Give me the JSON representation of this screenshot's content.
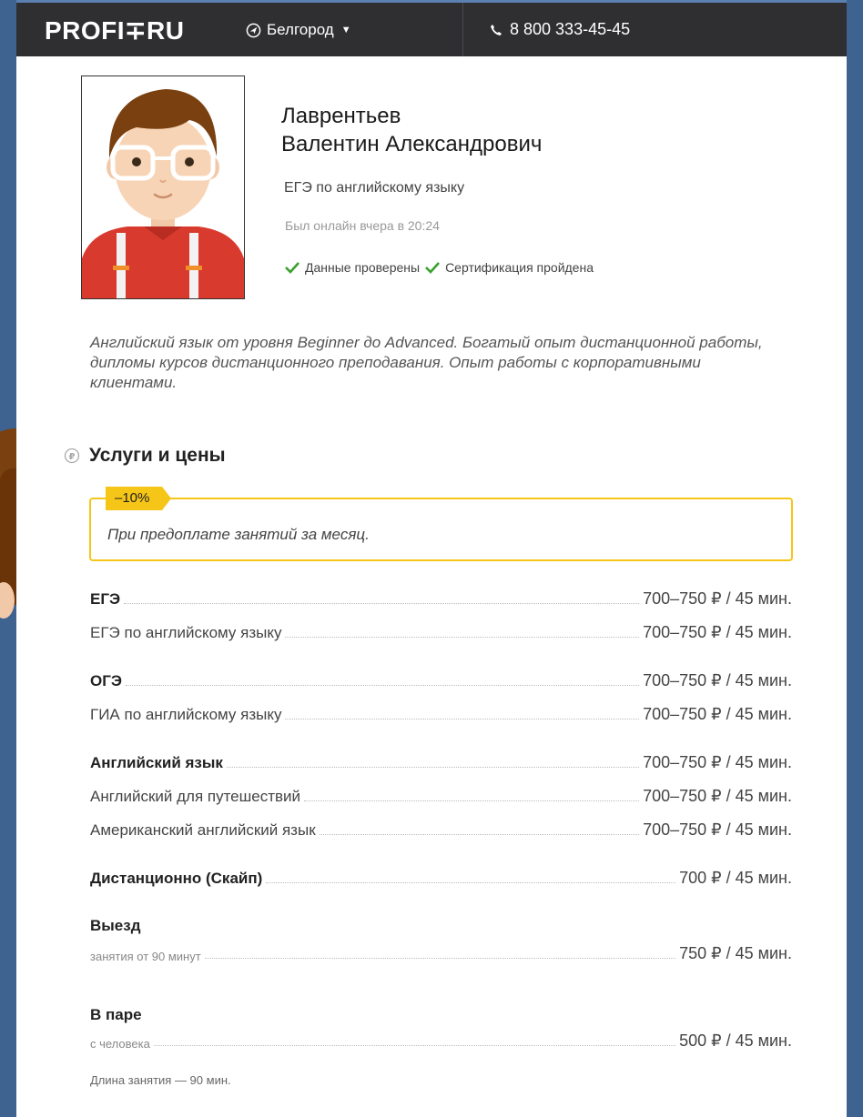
{
  "header": {
    "logo": "PROFI∓RU",
    "city": "Белгород",
    "phone": "8 800 333-45-45"
  },
  "profile": {
    "last_name": "Лаврентьев",
    "first_names": "Валентин Александрович",
    "subject": "ЕГЭ по английскому языку",
    "online": "Был онлайн вчера в 20:24",
    "badge_verified": "Данные проверены",
    "badge_certified": "Сертификация пройдена",
    "about": "Английский язык от уровня Beginner до Advanced. Богатый опыт дистанционной работы, дипломы курсов дистанционного преподавания. Опыт работы с корпоративными клиентами."
  },
  "services": {
    "title": "Услуги и цены",
    "discount_tag": "–10%",
    "discount_text": "При предоплате занятий за месяц.",
    "rows": [
      {
        "label": "ЕГЭ",
        "price": "700–750 ₽ / 45 мин."
      },
      {
        "label": "ЕГЭ по английскому языку",
        "price": "700–750 ₽ / 45 мин."
      },
      {
        "label": "ОГЭ",
        "price": "700–750 ₽ / 45 мин."
      },
      {
        "label": "ГИА по английскому языку",
        "price": "700–750 ₽ / 45 мин."
      },
      {
        "label": "Английский язык",
        "price": "700–750 ₽ / 45 мин."
      },
      {
        "label": "Английский для путешествий",
        "price": "700–750 ₽ / 45 мин."
      },
      {
        "label": "Американский английский язык",
        "price": "700–750 ₽ / 45 мин."
      },
      {
        "label": "Дистанционно (Скайп)",
        "price": "700 ₽ / 45 мин."
      },
      {
        "label": "занятия от 90 минут",
        "price": "750 ₽ / 45 мин."
      },
      {
        "label": "с человека",
        "price": "500 ₽ / 45 мин."
      }
    ],
    "heading_visit": "Выезд",
    "heading_pair": "В паре",
    "note": "Длина занятия — 90 мин."
  },
  "colors": {
    "topbar": "#2f2f32",
    "background": "#3e6391",
    "accent": "#f5c518",
    "check": "#3aa02c"
  }
}
